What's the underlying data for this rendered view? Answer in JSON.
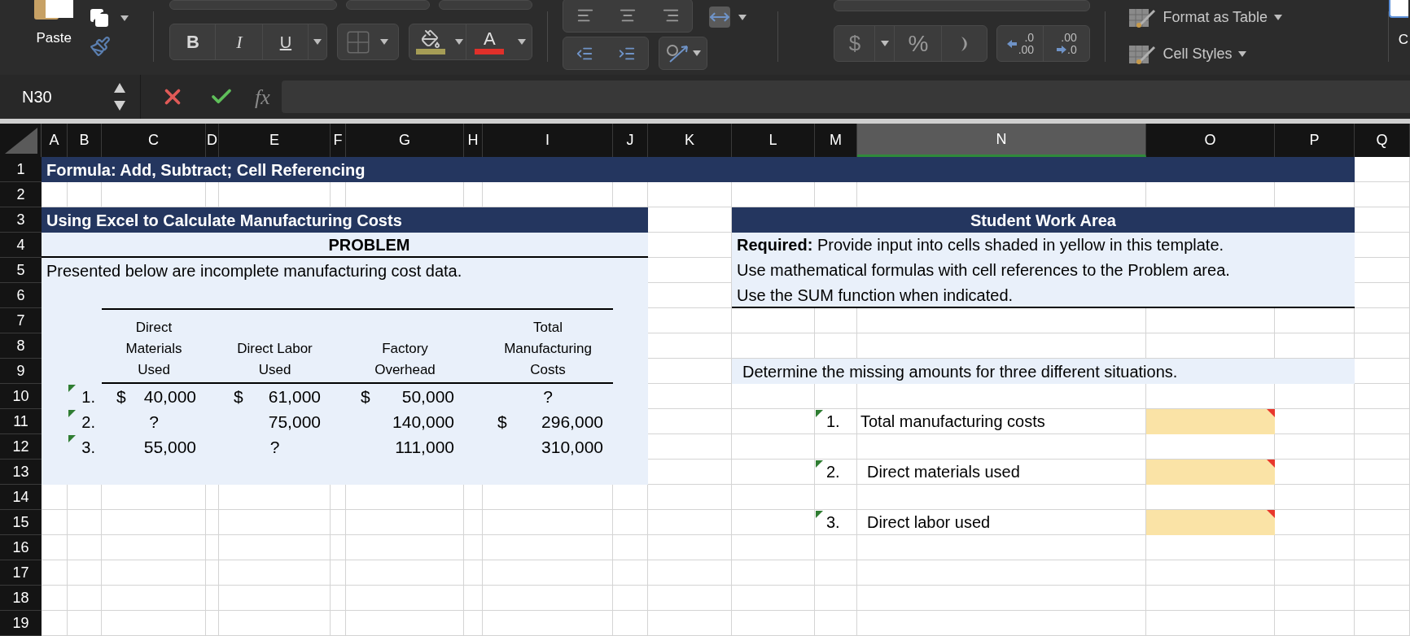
{
  "ribbon": {
    "paste_label": "Paste",
    "bold": "B",
    "italic": "I",
    "underline": "U",
    "font_color": "A",
    "currency": "$",
    "percent": "%",
    "increase_decimal": [
      ".0",
      ".00"
    ],
    "decrease_decimal": [
      ".00",
      ".0"
    ],
    "styles": [
      {
        "label": "Format as Table"
      },
      {
        "label": "Cell Styles"
      }
    ],
    "edge_label": "C"
  },
  "formula_bar": {
    "name_box": "N30",
    "function_label": "fx"
  },
  "sheet": {
    "columns": [
      {
        "label": "A",
        "selected": false
      },
      {
        "label": "B",
        "selected": false
      },
      {
        "label": "C",
        "selected": false
      },
      {
        "label": "D",
        "selected": false
      },
      {
        "label": "E",
        "selected": false
      },
      {
        "label": "F",
        "selected": false
      },
      {
        "label": "G",
        "selected": false
      },
      {
        "label": "H",
        "selected": false
      },
      {
        "label": "I",
        "selected": false
      },
      {
        "label": "J",
        "selected": false
      },
      {
        "label": "K",
        "selected": false
      },
      {
        "label": "L",
        "selected": false
      },
      {
        "label": "M",
        "selected": false
      },
      {
        "label": "N",
        "selected": true
      },
      {
        "label": "O",
        "selected": false
      },
      {
        "label": "P",
        "selected": false
      },
      {
        "label": "Q",
        "selected": false
      }
    ],
    "rows": [
      "1",
      "2",
      "3",
      "4",
      "5",
      "6",
      "7",
      "8",
      "9",
      "10",
      "11",
      "12",
      "13",
      "14",
      "15",
      "16",
      "17",
      "18",
      "19"
    ],
    "title": "Formula: Add, Subtract; Cell Referencing",
    "problem": {
      "heading": "Using Excel to Calculate Manufacturing Costs",
      "label": "PROBLEM",
      "intro": "Presented below are incomplete manufacturing cost data.",
      "columns": [
        {
          "lines": [
            "Direct",
            "Materials",
            "Used"
          ]
        },
        {
          "lines": [
            "Direct Labor",
            "Used"
          ]
        },
        {
          "lines": [
            "Factory",
            "Overhead"
          ]
        },
        {
          "lines": [
            "Total",
            "Manufacturing",
            "Costs"
          ]
        }
      ],
      "rows": [
        {
          "number": "1.",
          "flagged": true,
          "cells": [
            {
              "kind": "amount",
              "currency": "$",
              "value": "40,000"
            },
            {
              "kind": "amount",
              "currency": "$",
              "value": "61,000"
            },
            {
              "kind": "amount",
              "currency": "$",
              "value": "50,000"
            },
            {
              "kind": "unknown",
              "value": "?"
            }
          ]
        },
        {
          "number": "2.",
          "flagged": true,
          "cells": [
            {
              "kind": "unknown",
              "value": "?"
            },
            {
              "kind": "amount",
              "value": "75,000"
            },
            {
              "kind": "amount",
              "value": "140,000"
            },
            {
              "kind": "amount",
              "currency": "$",
              "value": "296,000"
            }
          ]
        },
        {
          "number": "3.",
          "flagged": true,
          "cells": [
            {
              "kind": "amount",
              "value": "55,000"
            },
            {
              "kind": "unknown",
              "value": "?"
            },
            {
              "kind": "amount",
              "value": "111,000"
            },
            {
              "kind": "amount",
              "value": "310,000"
            }
          ]
        }
      ]
    },
    "work_area": {
      "heading": "Student Work Area",
      "instructions": [
        "**Required:** Provide input into cells shaded in yellow in this template.",
        "Use mathematical formulas with cell references to the Problem area.",
        "Use the SUM function when indicated."
      ],
      "prompt": "Determine the missing amounts for three different situations.",
      "answers": [
        {
          "number": "1.",
          "flagged": true,
          "label": "Total manufacturing costs",
          "commented": true
        },
        {
          "number": "2.",
          "flagged": true,
          "label": "Direct materials used",
          "commented": true
        },
        {
          "number": "3.",
          "flagged": true,
          "label": "Direct labor used",
          "commented": true
        }
      ]
    }
  }
}
